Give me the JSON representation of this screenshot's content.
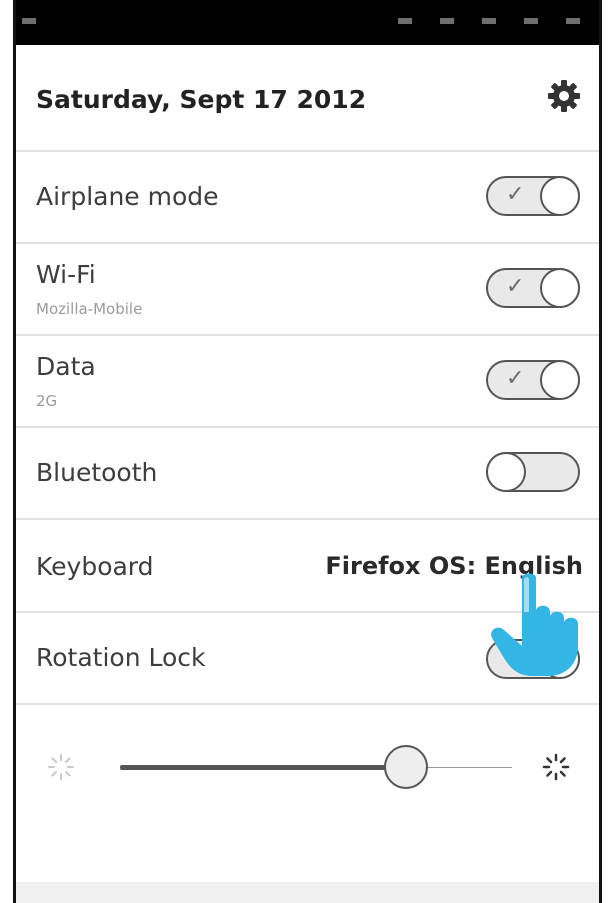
{
  "header": {
    "date": "Saturday, Sept 17 2012",
    "settings_icon": "gear-icon"
  },
  "settings": {
    "airplane": {
      "label": "Airplane mode",
      "enabled": true
    },
    "wifi": {
      "label": "Wi-Fi",
      "network": "Mozilla-Mobile",
      "enabled": true
    },
    "data": {
      "label": "Data",
      "type": "2G",
      "enabled": true
    },
    "bluetooth": {
      "label": "Bluetooth",
      "enabled": false
    },
    "keyboard": {
      "label": "Keyboard",
      "value": "Firefox OS: English"
    },
    "rotation": {
      "label": "Rotation Lock",
      "enabled": true
    }
  },
  "brightness": {
    "level": 0.73,
    "low_icon": "brightness-low-icon",
    "high_icon": "brightness-high-icon"
  },
  "pointer": {
    "icon": "hand-pointer-icon"
  },
  "colors": {
    "status_bar": "#000000",
    "hand": "#33b5e5",
    "divider": "#e2e2e2"
  }
}
